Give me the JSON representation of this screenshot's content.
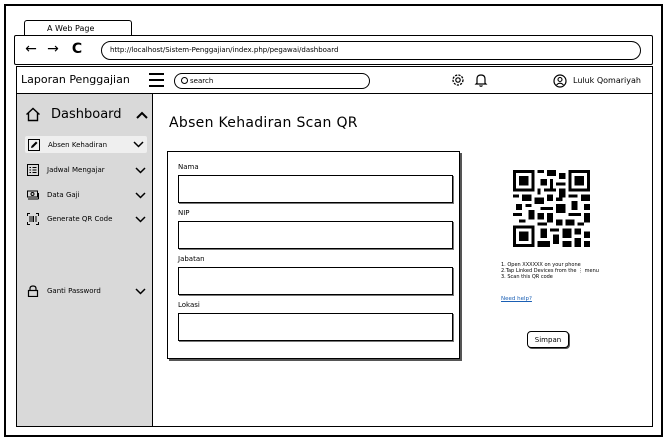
{
  "browser": {
    "tab_title": "A Web Page",
    "url": "http://localhost/Sistem-Penggajian/index.php/pegawai/dashboard",
    "back_glyph": "←",
    "forward_glyph": "→",
    "reload_glyph": "C"
  },
  "header": {
    "app_title": "Laporan Penggajian",
    "search_placeholder": "search",
    "user_name": "Luluk Qomariyah"
  },
  "sidebar": {
    "dashboard_label": "Dashboard",
    "items": [
      {
        "label": "Absen Kehadiran",
        "icon": "edit-icon"
      },
      {
        "label": "Jadwal Mengajar",
        "icon": "list-icon"
      },
      {
        "label": "Data Gaji",
        "icon": "money-icon"
      },
      {
        "label": "Generate QR Code",
        "icon": "qr-scan-icon"
      },
      {
        "label": "Ganti Password",
        "icon": "lock-icon"
      }
    ]
  },
  "main": {
    "title": "Absen Kehadiran Scan QR",
    "fields": [
      {
        "label": "Nama",
        "value": ""
      },
      {
        "label": "NIP",
        "value": ""
      },
      {
        "label": "Jabatan",
        "value": ""
      },
      {
        "label": "Lokasi",
        "value": ""
      }
    ],
    "instructions": [
      "1. Open XXXXXX on your phone",
      "2.Tap Linked Devices from the  ⋮  menu",
      "3. Scan this QR code"
    ],
    "help_link": "Need help?",
    "save_label": "Simpan"
  },
  "colors": {
    "sidebar_bg": "#d9d9d9",
    "link": "#1a5fb4"
  }
}
